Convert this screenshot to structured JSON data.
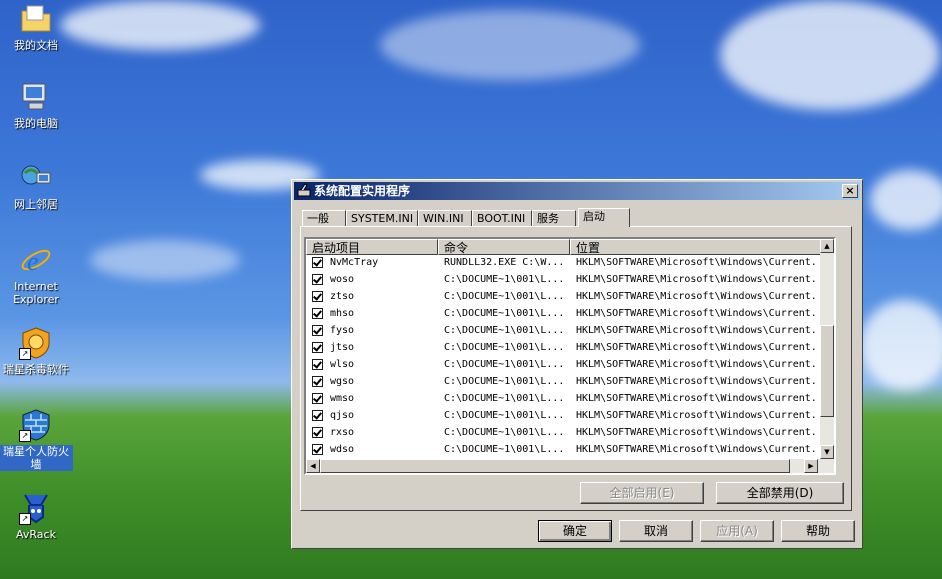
{
  "desktop": {
    "icons": [
      {
        "label": "我的文档"
      },
      {
        "label": "我的电脑"
      },
      {
        "label": "网上邻居"
      },
      {
        "label": "Internet Explorer"
      },
      {
        "label": "瑞星杀毒软件"
      },
      {
        "label": "瑞星个人防火墙"
      },
      {
        "label": "AvRack"
      }
    ]
  },
  "dialog": {
    "title": "系统配置实用程序",
    "close_label": "×",
    "tabs": [
      {
        "label": "一般"
      },
      {
        "label": "SYSTEM.INI"
      },
      {
        "label": "WIN.INI"
      },
      {
        "label": "BOOT.INI"
      },
      {
        "label": "服务"
      },
      {
        "label": "启动"
      }
    ],
    "active_tab": "启动",
    "columns": [
      "启动项目",
      "命令",
      "位置"
    ],
    "rows": [
      {
        "name": "NvMcTray",
        "command": "RUNDLL32.EXE C:\\W...",
        "location": "HKLM\\SOFTWARE\\Microsoft\\Windows\\Current..."
      },
      {
        "name": "woso",
        "command": "C:\\DOCUME~1\\001\\L...",
        "location": "HKLM\\SOFTWARE\\Microsoft\\Windows\\Current..."
      },
      {
        "name": "ztso",
        "command": "C:\\DOCUME~1\\001\\L...",
        "location": "HKLM\\SOFTWARE\\Microsoft\\Windows\\Current..."
      },
      {
        "name": "mhso",
        "command": "C:\\DOCUME~1\\001\\L...",
        "location": "HKLM\\SOFTWARE\\Microsoft\\Windows\\Current..."
      },
      {
        "name": "fyso",
        "command": "C:\\DOCUME~1\\001\\L...",
        "location": "HKLM\\SOFTWARE\\Microsoft\\Windows\\Current..."
      },
      {
        "name": "jtso",
        "command": "C:\\DOCUME~1\\001\\L...",
        "location": "HKLM\\SOFTWARE\\Microsoft\\Windows\\Current..."
      },
      {
        "name": "wlso",
        "command": "C:\\DOCUME~1\\001\\L...",
        "location": "HKLM\\SOFTWARE\\Microsoft\\Windows\\Current..."
      },
      {
        "name": "wgso",
        "command": "C:\\DOCUME~1\\001\\L...",
        "location": "HKLM\\SOFTWARE\\Microsoft\\Windows\\Current..."
      },
      {
        "name": "wmso",
        "command": "C:\\DOCUME~1\\001\\L...",
        "location": "HKLM\\SOFTWARE\\Microsoft\\Windows\\Current..."
      },
      {
        "name": "qjso",
        "command": "C:\\DOCUME~1\\001\\L...",
        "location": "HKLM\\SOFTWARE\\Microsoft\\Windows\\Current..."
      },
      {
        "name": "rxso",
        "command": "C:\\DOCUME~1\\001\\L...",
        "location": "HKLM\\SOFTWARE\\Microsoft\\Windows\\Current..."
      },
      {
        "name": "wdso",
        "command": "C:\\DOCUME~1\\001\\L...",
        "location": "HKLM\\SOFTWARE\\Microsoft\\Windows\\Current..."
      }
    ],
    "buttons": {
      "enable_all": "全部启用(E)",
      "disable_all": "全部禁用(D)",
      "ok": "确定",
      "cancel": "取消",
      "apply": "应用(A)",
      "help": "帮助"
    }
  },
  "colors": {
    "titlebar_start": "#0a246a",
    "titlebar_end": "#a6caf0",
    "dialog_face": "#d4d0c8",
    "desktop_sky": "#3d78d8",
    "desktop_grass": "#3f8f2a"
  }
}
